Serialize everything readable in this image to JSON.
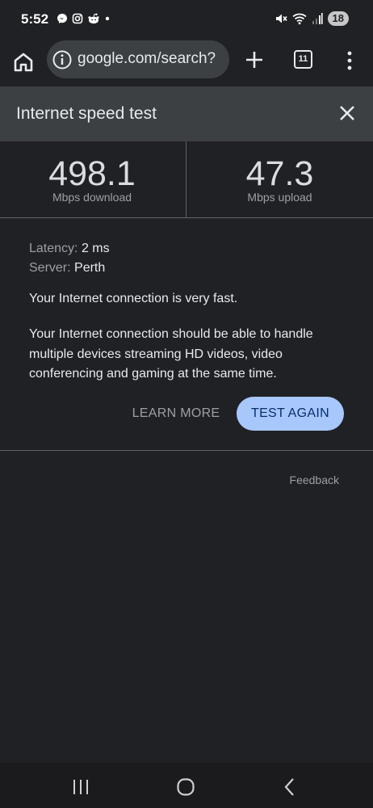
{
  "status_bar": {
    "time": "5:52",
    "left_icons": [
      "messenger-icon",
      "instagram-icon",
      "reddit-icon",
      "dot-icon"
    ],
    "right_icons": [
      "mute-icon",
      "wifi-icon",
      "signal-icon"
    ],
    "battery": "18"
  },
  "toolbar": {
    "url": "google.com/search?",
    "tab_count": "11"
  },
  "speed_test": {
    "title": "Internet speed test",
    "download_value": "498.1",
    "download_unit": "Mbps download",
    "upload_value": "47.3",
    "upload_unit": "Mbps upload",
    "latency_label": "Latency:",
    "latency_value": "2 ms",
    "server_label": "Server:",
    "server_value": "Perth",
    "summary": "Your Internet connection is very fast.",
    "description": "Your Internet connection should be able to handle multiple devices streaming HD videos, video conferencing and gaming at the same time.",
    "learn_more_label": "LEARN MORE",
    "test_again_label": "TEST AGAIN",
    "feedback_label": "Feedback"
  },
  "colors": {
    "background": "#202124",
    "header_bg": "#3c4043",
    "accent_button": "#a8c7fa"
  }
}
